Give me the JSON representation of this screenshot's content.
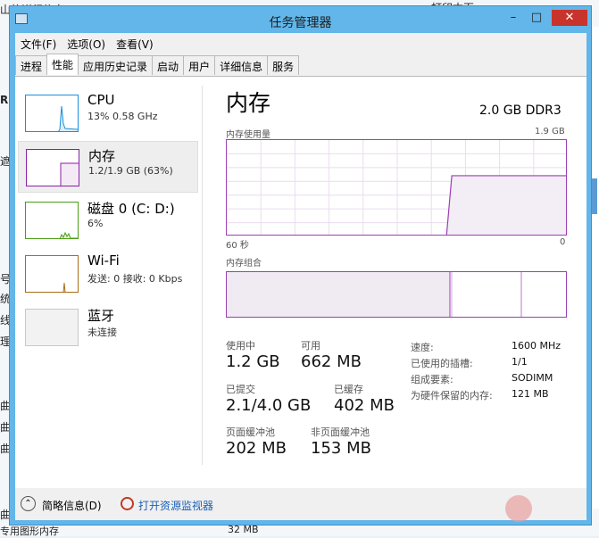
{
  "background_window": {
    "top_left_text": "山的详细信息",
    "top_center_text": "打印本页",
    "left_glyphs": [
      "R",
      "遮",
      "号",
      "统",
      "线",
      "理",
      "曲",
      "曲",
      "曲",
      "曲"
    ],
    "bottom_left_text": "专用图形内存",
    "bottom_value": "32 MB"
  },
  "window": {
    "title": "任务管理器",
    "controls": {
      "minimize": "–",
      "maximize": "□",
      "close": "✕"
    }
  },
  "menu": [
    "文件(F)",
    "选项(O)",
    "查看(V)"
  ],
  "tabs": [
    {
      "label": "进程",
      "active": false
    },
    {
      "label": "性能",
      "active": true
    },
    {
      "label": "应用历史记录",
      "active": false
    },
    {
      "label": "启动",
      "active": false
    },
    {
      "label": "用户",
      "active": false
    },
    {
      "label": "详细信息",
      "active": false
    },
    {
      "label": "服务",
      "active": false
    }
  ],
  "resources": [
    {
      "name": "CPU",
      "sub": "13% 0.58 GHz",
      "color": "#1b8fd8"
    },
    {
      "name": "内存",
      "sub": "1.2/1.9 GB (63%)",
      "color": "#8b1fa6"
    },
    {
      "name": "磁盘 0 (C: D:)",
      "sub": "6%",
      "color": "#4b9c15"
    },
    {
      "name": "Wi-Fi",
      "sub": "发送: 0 接收: 0 Kbps",
      "color": "#a86d16"
    },
    {
      "name": "蓝牙",
      "sub": "未连接",
      "color": "#b0b0b0"
    }
  ],
  "detail": {
    "title": "内存",
    "spec": "2.0 GB DDR3",
    "usage_label": "内存使用量",
    "usage_max": "1.9 GB",
    "axis_left": "60 秒",
    "axis_right": "0",
    "composition_label": "内存组合",
    "stats": {
      "in_use_label": "使用中",
      "in_use": "1.2 GB",
      "available_label": "可用",
      "available": "662 MB",
      "committed_label": "已提交",
      "committed": "2.1/4.0 GB",
      "cached_label": "已缓存",
      "cached": "402 MB",
      "paged_label": "页面缓冲池",
      "paged": "202 MB",
      "nonpaged_label": "非页面缓冲池",
      "nonpaged": "153 MB"
    },
    "kv": [
      {
        "label": "速度:",
        "value": "1600 MHz"
      },
      {
        "label": "已使用的插槽:",
        "value": "1/1"
      },
      {
        "label": "组成要素:",
        "value": "SODIMM"
      },
      {
        "label": "为硬件保留的内存:",
        "value": "121 MB"
      }
    ],
    "usage_fraction": 0.63
  },
  "footer": {
    "brief": "简略信息(D)",
    "monitor": "打开资源监视器"
  }
}
